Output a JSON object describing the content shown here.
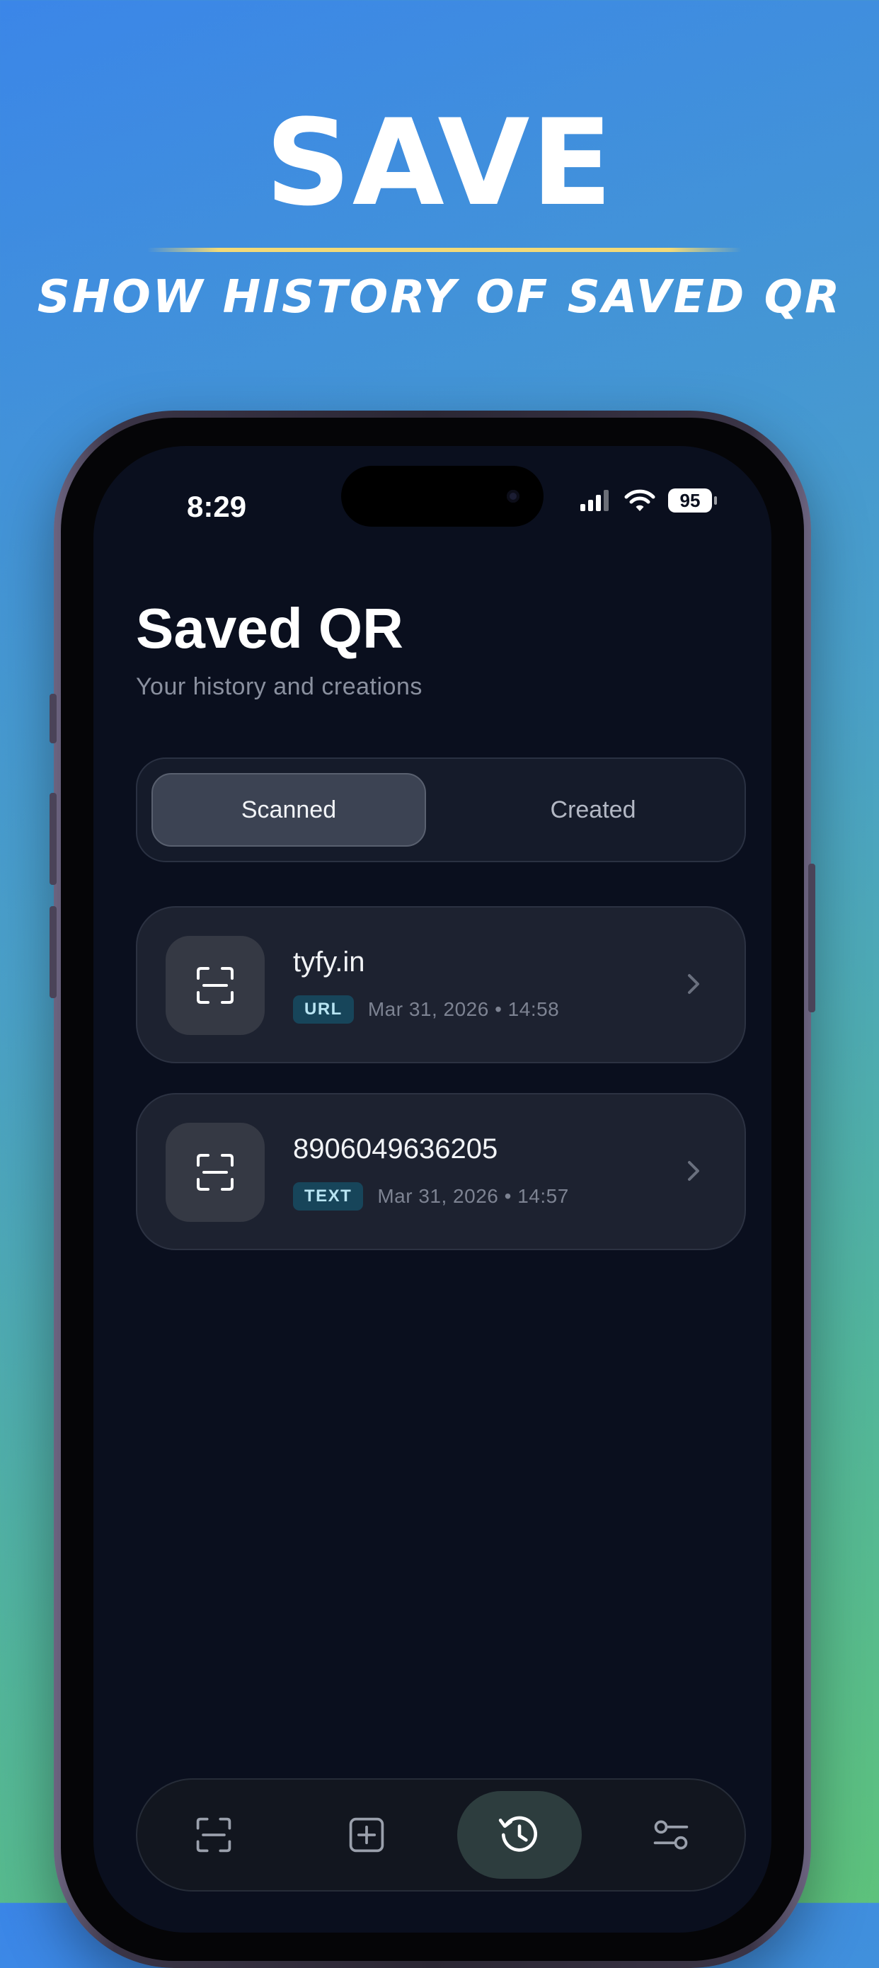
{
  "marketing": {
    "headline": "SAVE",
    "subheadline": "SHOW HISTORY OF SAVED QR"
  },
  "status_bar": {
    "time": "8:29",
    "battery": "95"
  },
  "header": {
    "title": "Saved QR",
    "subtitle": "Your history and creations"
  },
  "segmented": {
    "tabs": [
      {
        "label": "Scanned",
        "active": true
      },
      {
        "label": "Created",
        "active": false
      }
    ]
  },
  "history": {
    "items": [
      {
        "title": "tyfy.in",
        "type": "URL",
        "timestamp": "Mar 31, 2026 • 14:58",
        "icon": "scan-icon"
      },
      {
        "title": "8906049636205",
        "type": "TEXT",
        "timestamp": "Mar 31, 2026 • 14:57",
        "icon": "scan-icon"
      }
    ]
  },
  "tab_bar": {
    "items": [
      {
        "icon": "scan-icon",
        "active": false
      },
      {
        "icon": "add-square-icon",
        "active": false
      },
      {
        "icon": "history-icon",
        "active": true
      },
      {
        "icon": "settings-sliders-icon",
        "active": false
      }
    ]
  },
  "colors": {
    "screen_bg": "#0a0f1e",
    "card_bg": "#1d2230",
    "badge_bg": "#17455a",
    "badge_text": "#b8e4f2",
    "accent_rule": "#f2da78"
  }
}
